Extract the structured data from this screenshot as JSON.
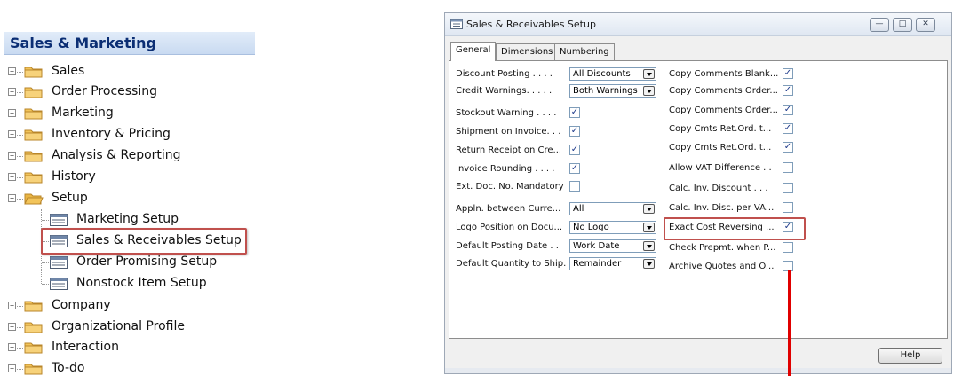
{
  "nav": {
    "title": "Sales & Marketing",
    "items": [
      {
        "label": "Sales",
        "kind": "folder",
        "state": "collapsed"
      },
      {
        "label": "Order Processing",
        "kind": "folder",
        "state": "collapsed"
      },
      {
        "label": "Marketing",
        "kind": "folder",
        "state": "collapsed"
      },
      {
        "label": "Inventory & Pricing",
        "kind": "folder",
        "state": "collapsed"
      },
      {
        "label": "Analysis & Reporting",
        "kind": "folder",
        "state": "collapsed"
      },
      {
        "label": "History",
        "kind": "folder",
        "state": "collapsed"
      },
      {
        "label": "Setup",
        "kind": "folder",
        "state": "expanded"
      },
      {
        "label": "Marketing Setup",
        "kind": "page"
      },
      {
        "label": "Sales & Receivables Setup",
        "kind": "page",
        "selected": true
      },
      {
        "label": "Order Promising Setup",
        "kind": "page"
      },
      {
        "label": "Nonstock Item Setup",
        "kind": "page"
      },
      {
        "label": "Company",
        "kind": "folder",
        "state": "collapsed"
      },
      {
        "label": "Organizational Profile",
        "kind": "folder",
        "state": "collapsed"
      },
      {
        "label": "Interaction",
        "kind": "folder",
        "state": "collapsed"
      },
      {
        "label": "To-do",
        "kind": "folder",
        "state": "collapsed"
      }
    ]
  },
  "window": {
    "title": "Sales & Receivables Setup",
    "tabs": [
      {
        "label": "General",
        "active": true
      },
      {
        "label": "Dimensions",
        "active": false
      },
      {
        "label": "Numbering",
        "active": false
      }
    ],
    "left_fields": [
      {
        "label": "Discount Posting . . . .",
        "type": "dropdown",
        "value": "All Discounts"
      },
      {
        "label": "Credit Warnings. . . . .",
        "type": "dropdown",
        "value": "Both Warnings"
      },
      {
        "label": "Stockout Warning . . . .",
        "type": "checkbox",
        "checked": true
      },
      {
        "label": "Shipment on Invoice. . .",
        "type": "checkbox",
        "checked": true
      },
      {
        "label": "Return Receipt on Cre...",
        "type": "checkbox",
        "checked": true
      },
      {
        "label": "Invoice Rounding . . . .",
        "type": "checkbox",
        "checked": true
      },
      {
        "label": "Ext. Doc. No. Mandatory",
        "type": "checkbox",
        "checked": false
      },
      {
        "label": "Appln. between Curre...",
        "type": "dropdown",
        "value": "All"
      },
      {
        "label": "Logo Position on Docu...",
        "type": "dropdown",
        "value": "No Logo"
      },
      {
        "label": "Default Posting Date . .",
        "type": "dropdown",
        "value": "Work Date"
      },
      {
        "label": "Default Quantity to Ship.",
        "type": "dropdown",
        "value": "Remainder"
      }
    ],
    "right_fields": [
      {
        "label": "Copy Comments Blank...",
        "checked": true
      },
      {
        "label": "Copy Comments Order...",
        "checked": true
      },
      {
        "label": "Copy Comments Order...",
        "checked": true
      },
      {
        "label": "Copy Cmts Ret.Ord. t...",
        "checked": true
      },
      {
        "label": "Copy Cmts Ret.Ord. t...",
        "checked": true
      },
      {
        "label": "Allow VAT Difference . .",
        "checked": false
      },
      {
        "label": "Calc. Inv. Discount . . .",
        "checked": false
      },
      {
        "label": "Calc. Inv. Disc. per VA...",
        "checked": false
      },
      {
        "label": "Exact Cost Reversing ...",
        "checked": true,
        "highlighted": true
      },
      {
        "label": "Check Prepmt. when P...",
        "checked": false
      },
      {
        "label": "Archive Quotes and O...",
        "checked": false
      }
    ],
    "help_label": "Help",
    "check_mark": "✓",
    "controls": {
      "minimize": "—",
      "maximize": "□",
      "close": "✕"
    }
  },
  "colors": {
    "highlight_box": "#c0504d",
    "arrow": "#e00000",
    "nav_title": "#0b2e74",
    "folder": "#f2c45a"
  }
}
